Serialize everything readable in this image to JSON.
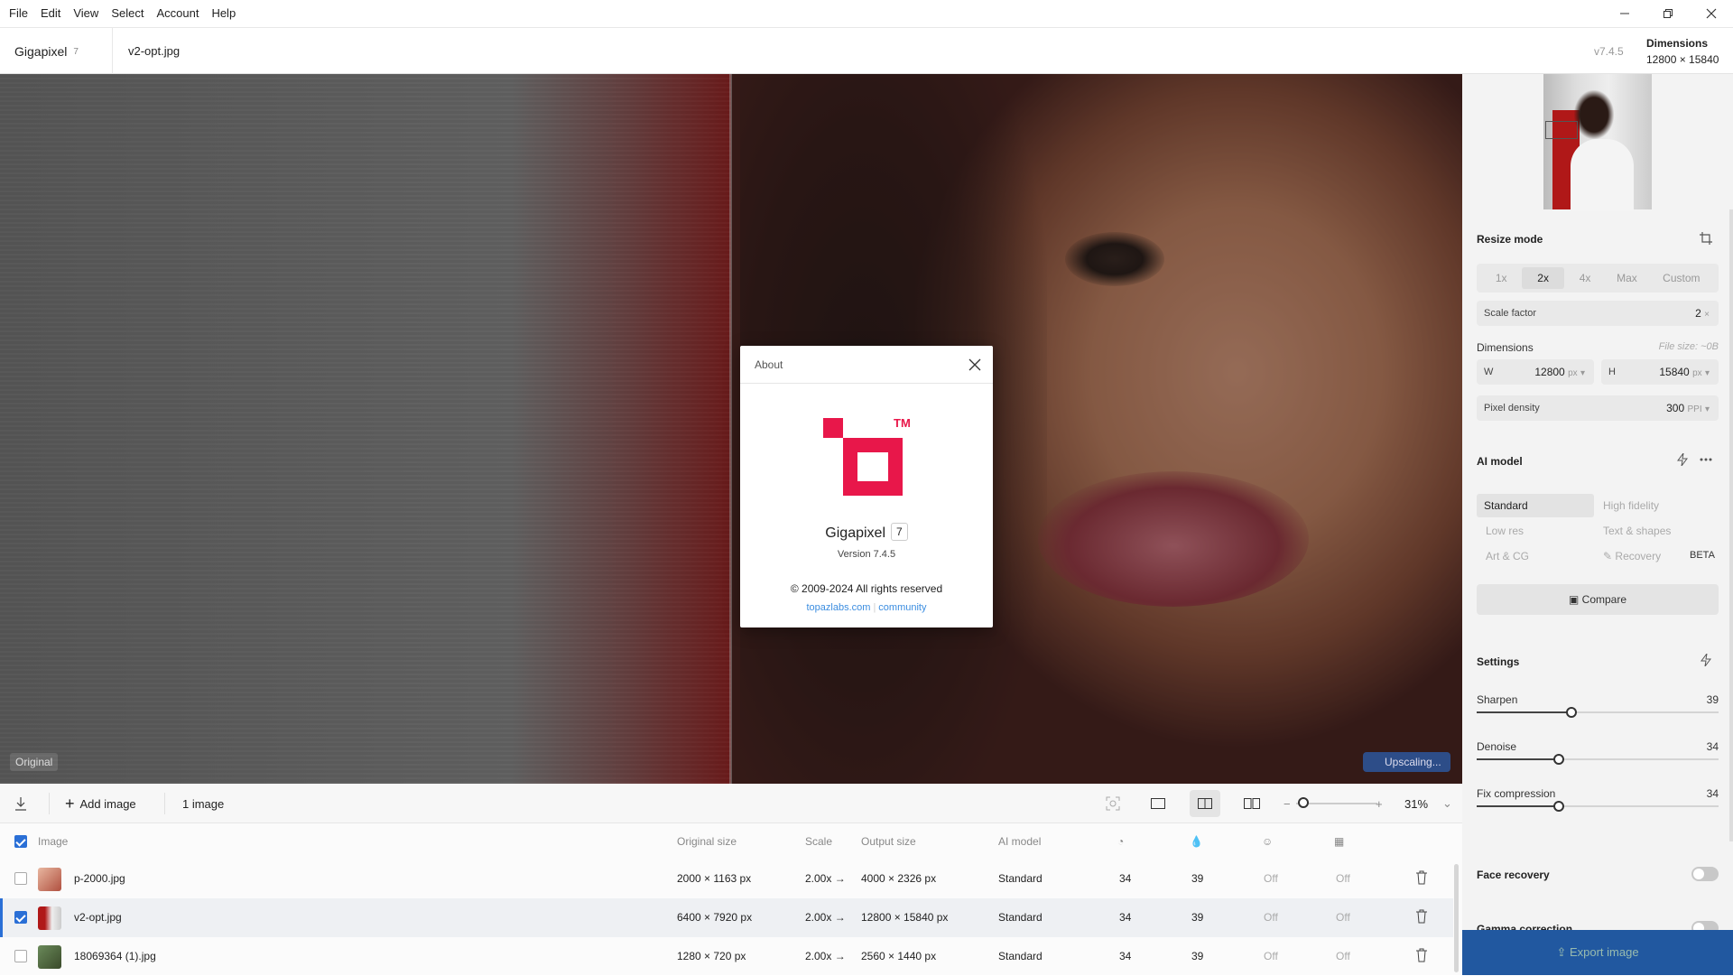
{
  "menu": [
    "File",
    "Edit",
    "View",
    "Select",
    "Account",
    "Help"
  ],
  "header": {
    "app_name": "Gigapixel",
    "app_major": "7",
    "file_tab": "v2-opt.jpg",
    "app_version": "v7.4.5",
    "dimensions_label": "Dimensions",
    "dimensions_value": "12800 × 15840"
  },
  "canvas": {
    "original_label": "Original",
    "upscaling_label": "Upscaling..."
  },
  "about": {
    "title": "About",
    "trademark": "TM",
    "product": "Gigapixel",
    "product_badge": "7",
    "version": "Version 7.4.5",
    "copyright": "© 2009-2024 All rights reserved",
    "link1": "topazlabs.com",
    "link_sep": "|",
    "link2": "community"
  },
  "panel": {
    "resize_mode": {
      "title": "Resize mode",
      "options": [
        "1x",
        "2x",
        "4x",
        "Max",
        "Custom"
      ],
      "active": "2x",
      "scale_factor_label": "Scale factor",
      "scale_factor_value": "2",
      "scale_factor_unit": "×"
    },
    "dimensions": {
      "title": "Dimensions",
      "file_size": "File size: ~0B",
      "w_label": "W",
      "w_value": "12800",
      "h_label": "H",
      "h_value": "15840",
      "unit": "px",
      "pixel_density_label": "Pixel density",
      "pixel_density_value": "300",
      "pixel_density_unit": "PPI"
    },
    "ai_model": {
      "title": "AI model",
      "models": [
        "Standard",
        "High fidelity",
        "Low res",
        "Text & shapes",
        "Art & CG",
        "Recovery"
      ],
      "active": "Standard",
      "beta": "BETA",
      "compare_label": "Compare"
    },
    "settings": {
      "title": "Settings",
      "sliders": [
        {
          "name": "Sharpen",
          "value": 39
        },
        {
          "name": "Denoise",
          "value": 34
        },
        {
          "name": "Fix compression",
          "value": 34
        }
      ]
    },
    "face_recovery": "Face recovery",
    "gamma_correction": "Gamma correction",
    "export": "Export image"
  },
  "toolbar": {
    "add_image": "Add image",
    "count": "1 image",
    "zoom": "31%"
  },
  "table": {
    "headers": {
      "image": "Image",
      "original_size": "Original size",
      "scale": "Scale",
      "output_size": "Output size",
      "ai_model": "AI model"
    },
    "rows": [
      {
        "name": "p-2000.jpg",
        "original": "2000 × 1163 px",
        "scale": "2.00x",
        "output": "4000 × 2326 px",
        "model": "Standard",
        "c1": "34",
        "c2": "39",
        "c3": "Off",
        "c4": "Off",
        "checked": false
      },
      {
        "name": "v2-opt.jpg",
        "original": "6400 × 7920 px",
        "scale": "2.00x",
        "output": "12800 × 15840 px",
        "model": "Standard",
        "c1": "34",
        "c2": "39",
        "c3": "Off",
        "c4": "Off",
        "checked": true
      },
      {
        "name": "18069364 (1).jpg",
        "original": "1280 × 720 px",
        "scale": "2.00x",
        "output": "2560 × 1440 px",
        "model": "Standard",
        "c1": "34",
        "c2": "39",
        "c3": "Off",
        "c4": "Off",
        "checked": false
      }
    ]
  },
  "colors": {
    "brand": "#e8174a",
    "accent": "#2a6fd6"
  }
}
